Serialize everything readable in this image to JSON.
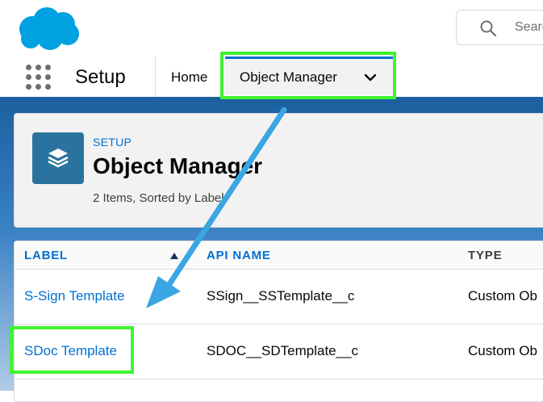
{
  "header": {
    "search_placeholder": "Search",
    "colors": {
      "brand": "#00a1e0",
      "accent": "#0070d2",
      "highlight": "#3ff52e",
      "arrow": "#3aa6e3"
    }
  },
  "nav": {
    "app_name": "Setup",
    "tabs": [
      {
        "label": "Home"
      },
      {
        "label": "Object Manager",
        "active": true,
        "icon": "chevron-down-icon"
      }
    ]
  },
  "page_header": {
    "breadcrumb": "SETUP",
    "title": "Object Manager",
    "meta": "2 Items, Sorted by Label",
    "icon": "layers-icon"
  },
  "table": {
    "columns": [
      "LABEL",
      "API NAME",
      "TYPE"
    ],
    "sort_column": "LABEL",
    "sort_direction": "ascending",
    "rows": [
      {
        "label": "S-Sign Template",
        "api_name": "SSign__SSTemplate__c",
        "type": "Custom Ob"
      },
      {
        "label": "SDoc Template",
        "api_name": "SDOC__SDTemplate__c",
        "type": "Custom Ob"
      }
    ]
  },
  "annotations": [
    {
      "target": "Object Manager tab",
      "style": "green box"
    },
    {
      "target": "SDoc Template",
      "style": "green box"
    }
  ]
}
